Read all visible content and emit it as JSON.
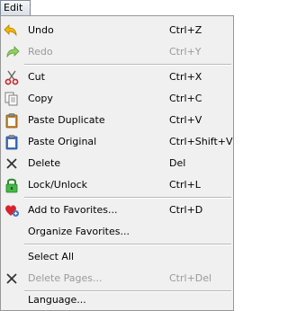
{
  "menubar": {
    "edit_label": "Edit"
  },
  "menu": {
    "items": [
      {
        "label": "Undo",
        "shortcut": "Ctrl+Z",
        "icon": "undo-icon",
        "enabled": true
      },
      {
        "label": "Redo",
        "shortcut": "Ctrl+Y",
        "icon": "redo-icon",
        "enabled": false
      },
      {
        "label": "Cut",
        "shortcut": "Ctrl+X",
        "icon": "scissors-icon",
        "enabled": true
      },
      {
        "label": "Copy",
        "shortcut": "Ctrl+C",
        "icon": "copy-icon",
        "enabled": true
      },
      {
        "label": "Paste Duplicate",
        "shortcut": "Ctrl+V",
        "icon": "clipboard-icon",
        "enabled": true
      },
      {
        "label": "Paste Original",
        "shortcut": "Ctrl+Shift+V",
        "icon": "clipboard-blue-icon",
        "enabled": true
      },
      {
        "label": "Delete",
        "shortcut": "Del",
        "icon": "x-icon",
        "enabled": true
      },
      {
        "label": "Lock/Unlock",
        "shortcut": "Ctrl+L",
        "icon": "lock-icon",
        "enabled": true
      },
      {
        "label": "Add to Favorites...",
        "shortcut": "Ctrl+D",
        "icon": "heart-plus-icon",
        "enabled": true
      },
      {
        "label": "Organize Favorites...",
        "shortcut": "",
        "icon": "",
        "enabled": true
      },
      {
        "label": "Select All",
        "shortcut": "",
        "icon": "",
        "enabled": true
      },
      {
        "label": "Delete Pages...",
        "shortcut": "Ctrl+Del",
        "icon": "x-icon",
        "enabled": false
      },
      {
        "label": "Language...",
        "shortcut": "",
        "icon": "",
        "enabled": true
      }
    ]
  },
  "colors": {
    "menu_background": "#f0f0f0",
    "disabled_text": "#9a9a9a",
    "undo_arrow": "#e8a800",
    "redo_arrow": "#7dc24a",
    "lock_green": "#3faa3f"
  }
}
